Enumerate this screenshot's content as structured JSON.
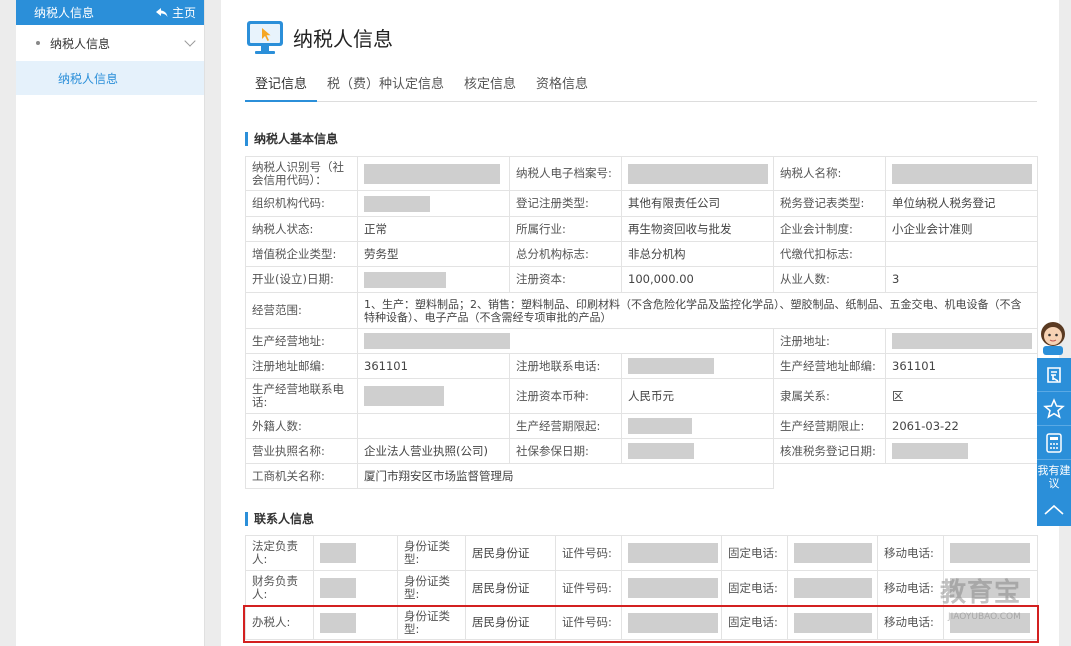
{
  "sidebar": {
    "header": "纳税人信息",
    "home": "主页",
    "group": "纳税人信息",
    "item": "纳税人信息"
  },
  "page": {
    "title": "纳税人信息",
    "tabs": [
      "登记信息",
      "税（费）种认定信息",
      "核定信息",
      "资格信息"
    ]
  },
  "basic": {
    "title": "纳税人基本信息",
    "labels": {
      "tin": "纳税人识别号（社会信用代码）：",
      "e_archive": "纳税人电子档案号:",
      "name": "纳税人名称:",
      "org_code": "组织机构代码:",
      "reg_type": "登记注册类型:",
      "form_type": "税务登记表类型:",
      "status": "纳税人状态:",
      "industry": "所属行业:",
      "accounting": "企业会计制度:",
      "vat_type": "增值税企业类型:",
      "branch_flag": "总分机构标志:",
      "withhold_flag": "代缴代扣标志:",
      "open_date": "开业(设立)日期:",
      "capital": "注册资本:",
      "employees": "从业人数:",
      "scope": "经营范围:",
      "biz_addr": "生产经营地址:",
      "reg_addr": "注册地址:",
      "reg_zip": "注册地址邮编:",
      "reg_phone": "注册地联系电话:",
      "biz_zip": "生产经营地址邮编:",
      "biz_phone": "生产经营地联系电话:",
      "currency": "注册资本币种:",
      "affiliation": "隶属关系:",
      "foreign": "外籍人数:",
      "term_start": "生产经营期限起:",
      "term_end": "生产经营期限止:",
      "license": "营业执照名称:",
      "insure_date": "社保参保日期:",
      "approve_date": "核准税务登记日期:",
      "authority": "工商机关名称:"
    },
    "values": {
      "reg_type": "其他有限责任公司",
      "form_type": "单位纳税人税务登记",
      "status": "正常",
      "industry": "再生物资回收与批发",
      "accounting": "小企业会计准则",
      "vat_type": "劳务型",
      "branch_flag": "非总分机构",
      "capital": "100,000.00",
      "employees": "3",
      "scope": "1、生产：塑料制品；2、销售：塑料制品、印刷材料（不含危险化学品及监控化学品）、塑胶制品、纸制品、五金交电、机电设备（不含特种设备）、电子产品（不含需经专项审批的产品）",
      "reg_zip": "361101",
      "biz_zip": "361101",
      "currency": "人民币元",
      "affiliation": "区",
      "term_end": "2061-03-22",
      "license": "企业法人营业执照(公司)",
      "authority": "厦门市翔安区市场监督管理局"
    }
  },
  "contacts": {
    "title": "联系人信息",
    "labels": {
      "id_type": "身份证类型:",
      "id_no": "证件号码:",
      "fixed": "固定电话:",
      "mobile": "移动电话:"
    },
    "rows": [
      {
        "role": "法定负责人:",
        "id_type": "居民身份证"
      },
      {
        "role": "财务负责人:",
        "id_type": "居民身份证"
      },
      {
        "role": "办税人:",
        "id_type": "居民身份证"
      }
    ]
  },
  "float_bar": {
    "suggest": "我有建议"
  },
  "watermark": {
    "main": "教育宝",
    "sub": "JIAOYUBAO.COM"
  },
  "colors": {
    "accent": "#2b8fd9",
    "highlight": "#d32020",
    "mask": "#cfcfcf"
  }
}
